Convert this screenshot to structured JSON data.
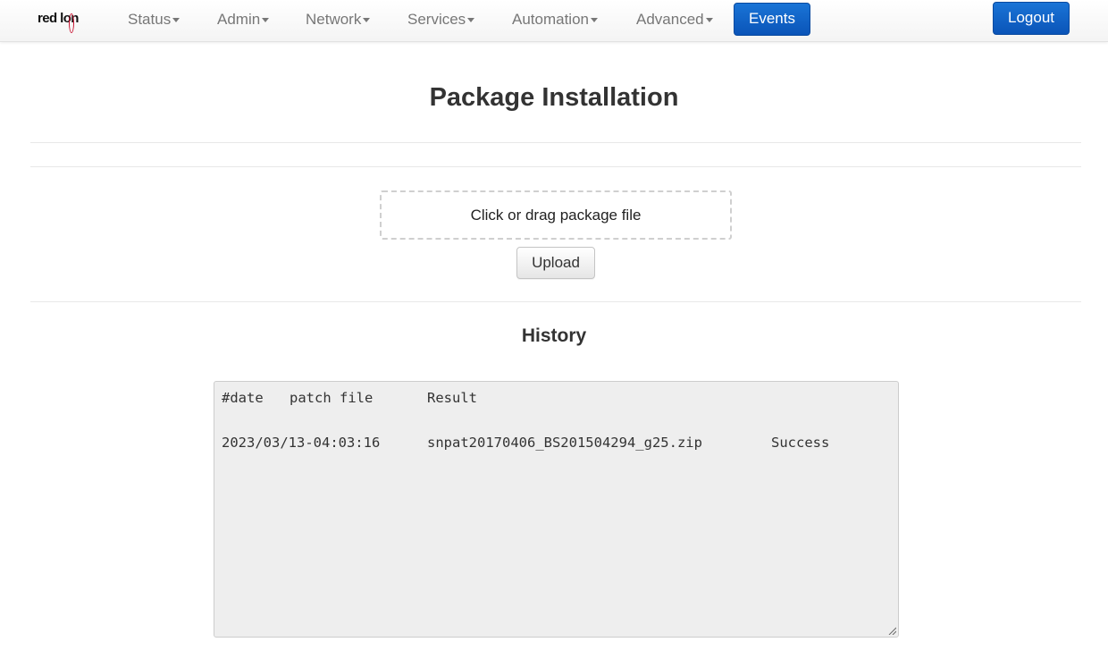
{
  "brand": {
    "logo_text_a": "red l",
    "logo_text_b": "on"
  },
  "nav": {
    "items": [
      {
        "label": "Status"
      },
      {
        "label": "Admin"
      },
      {
        "label": "Network"
      },
      {
        "label": "Services"
      },
      {
        "label": "Automation"
      },
      {
        "label": "Advanced"
      }
    ],
    "events_label": "Events",
    "logout_label": "Logout"
  },
  "page": {
    "title": "Package Installation",
    "dropzone_text": "Click or drag package file",
    "upload_label": "Upload",
    "history_title": "History"
  },
  "history": {
    "header": {
      "date": "#date",
      "patch_file": "patch file",
      "result": "Result"
    },
    "rows": [
      {
        "date": "2023/03/13-04:03:16",
        "patch_file": "snpat20170406_BS201504294_g25.zip",
        "result": "Success"
      }
    ]
  },
  "colors": {
    "accent": "#0a54b8",
    "nav_text": "#777777",
    "history_bg": "#eeeeee"
  }
}
